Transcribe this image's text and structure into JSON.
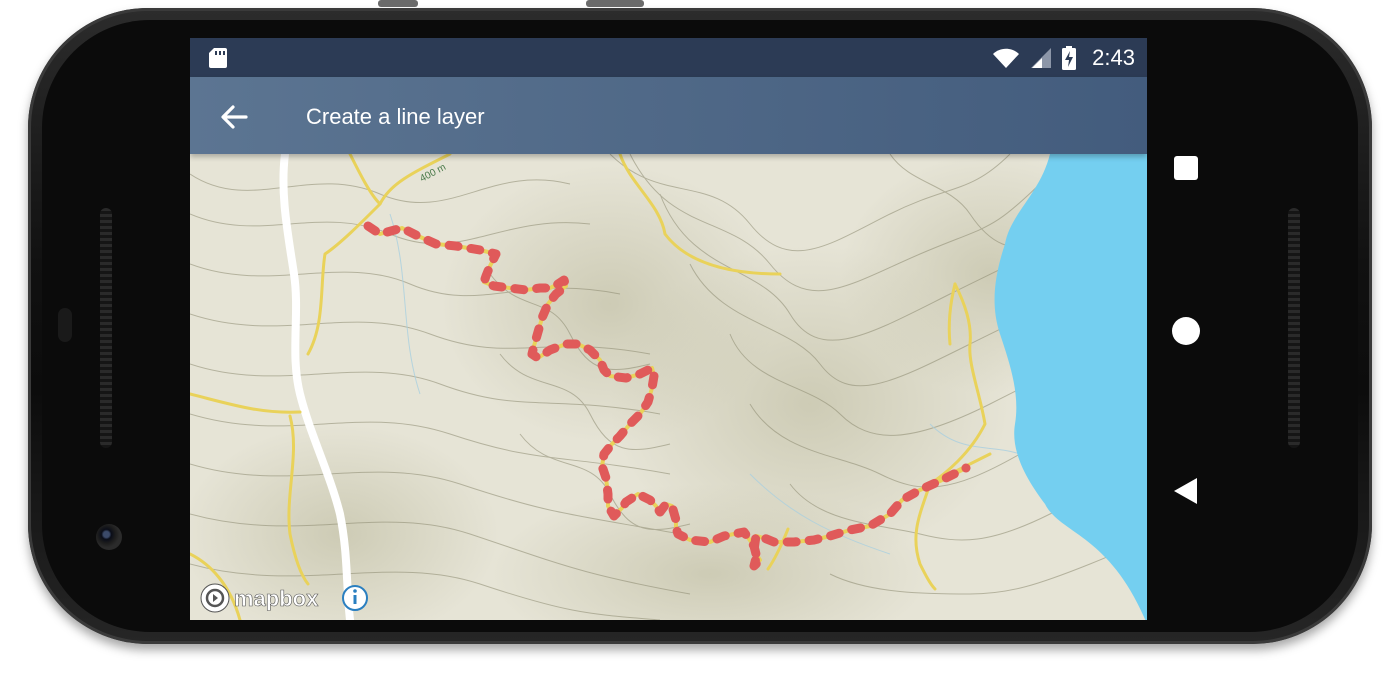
{
  "status_bar": {
    "time": "2:43",
    "icons": [
      "sd-card-icon",
      "wifi-icon",
      "cell-signal-icon",
      "battery-charging-icon"
    ]
  },
  "app_bar": {
    "title": "Create a line layer",
    "back_icon": "arrow-back-icon"
  },
  "map": {
    "contour_label": "400 m",
    "attribution_text": "mapbox",
    "info_icon": "info-icon",
    "route_line_color": "#e05a5a",
    "water_color": "#74cff0",
    "trail_color": "#e9d25a",
    "land_color": "#e6e4d6"
  },
  "nav_bar": {
    "buttons": [
      "overview-square-icon",
      "home-circle-icon",
      "back-triangle-icon"
    ]
  }
}
